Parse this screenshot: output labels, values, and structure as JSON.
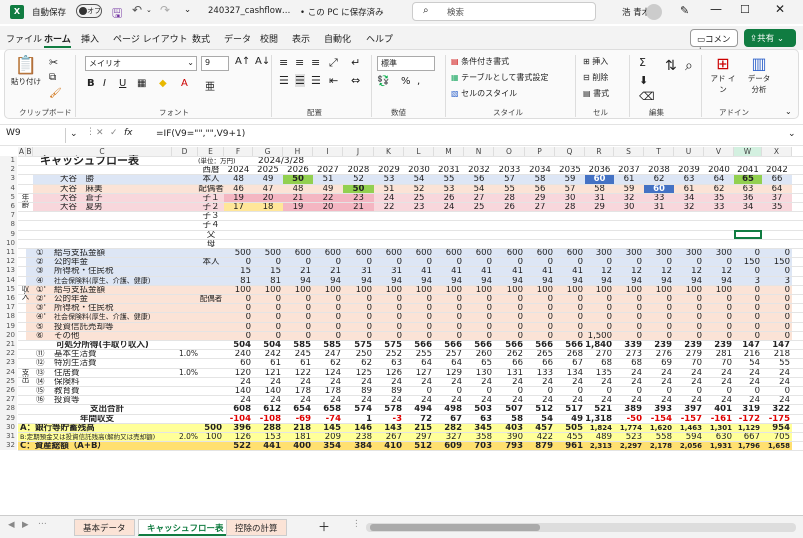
{
  "title_bar": {
    "autosave": "自動保存",
    "toggle": "オフ",
    "filename": "240327_cashflow…",
    "save_state": "• この PC に保存済み",
    "search": "検索",
    "user": "浩 青木"
  },
  "tabs": [
    "ファイル",
    "ホーム",
    "挿入",
    "ページ レイアウト",
    "数式",
    "データ",
    "校閲",
    "表示",
    "自動化",
    "ヘルプ"
  ],
  "comment_btn": "コメント",
  "share_btn": "共有",
  "ribbon": {
    "paste": "貼り付け",
    "font_name": "メイリオ",
    "font_size": "9",
    "number_format": "標準",
    "cond_format": "条件付き書式",
    "table_format": "テーブルとして書式設定",
    "cell_style": "セルのスタイル",
    "insert": "挿入",
    "delete": "削除",
    "format": "書式",
    "addin": "アド イン",
    "analyze": "データ 分析",
    "groups": [
      "クリップボード",
      "フォント",
      "配置",
      "数値",
      "スタイル",
      "セル",
      "編集",
      "アドイン"
    ]
  },
  "formula_bar": {
    "namebox": "W9",
    "fx": "fx",
    "formula": "=IF(V9=\"\",\"\",V9+1)"
  },
  "columns": [
    "A",
    "B",
    "C",
    "D",
    "E",
    "F",
    "G",
    "H",
    "I",
    "J",
    "K",
    "L",
    "M",
    "N",
    "O",
    "P",
    "Q",
    "R",
    "S",
    "T",
    "U",
    "V",
    "W",
    "X"
  ],
  "sheet": {
    "title": "キャッシュフロー表",
    "unit": "(単位：万円)",
    "date": "2024/3/28",
    "year_label": "西暦",
    "years": [
      "2024",
      "2025",
      "2026",
      "2027",
      "2028",
      "2029",
      "2030",
      "2031",
      "2032",
      "2033",
      "2034",
      "2035",
      "2036",
      "2037",
      "2038",
      "2039",
      "2040",
      "2041",
      "2042"
    ],
    "family_side": "年齢",
    "family": [
      {
        "name": "大谷　勝",
        "rel": "本人",
        "vals": [
          "48",
          "49",
          "50",
          "51",
          "52",
          "53",
          "54",
          "55",
          "56",
          "57",
          "58",
          "59",
          "60",
          "61",
          "62",
          "63",
          "64",
          "65",
          "66"
        ]
      },
      {
        "name": "大谷　麻美",
        "rel": "配偶者",
        "vals": [
          "46",
          "47",
          "48",
          "49",
          "50",
          "51",
          "52",
          "53",
          "54",
          "55",
          "56",
          "57",
          "58",
          "59",
          "60",
          "61",
          "62",
          "63",
          "64"
        ]
      },
      {
        "name": "大谷　蒼子",
        "rel": "子１",
        "vals": [
          "19",
          "20",
          "21",
          "22",
          "23",
          "24",
          "25",
          "26",
          "27",
          "28",
          "29",
          "30",
          "31",
          "32",
          "33",
          "34",
          "35",
          "36",
          "37"
        ]
      },
      {
        "name": "大谷　夏男",
        "rel": "子２",
        "vals": [
          "17",
          "18",
          "19",
          "20",
          "21",
          "22",
          "23",
          "24",
          "25",
          "26",
          "27",
          "28",
          "29",
          "30",
          "31",
          "32",
          "33",
          "34",
          "35"
        ]
      },
      {
        "name": "",
        "rel": "子３",
        "vals": []
      },
      {
        "name": "",
        "rel": "子４",
        "vals": []
      },
      {
        "name": "",
        "rel": "父",
        "vals": []
      },
      {
        "name": "",
        "rel": "母",
        "vals": []
      }
    ],
    "income_side": "収入",
    "income_self_label": "本人",
    "income_spouse_label": "配偶者",
    "income": [
      {
        "no": "①",
        "label": "給与支払金額",
        "vals": [
          "500",
          "500",
          "600",
          "600",
          "600",
          "600",
          "600",
          "600",
          "600",
          "600",
          "600",
          "600",
          "300",
          "300",
          "300",
          "300",
          "300",
          "0",
          "0"
        ]
      },
      {
        "no": "②",
        "label": "公的年金",
        "vals": [
          "0",
          "0",
          "0",
          "0",
          "0",
          "0",
          "0",
          "0",
          "0",
          "0",
          "0",
          "0",
          "0",
          "0",
          "0",
          "0",
          "0",
          "150",
          "150"
        ]
      },
      {
        "no": "③",
        "label": "所得税・住民税",
        "vals": [
          "15",
          "15",
          "21",
          "21",
          "31",
          "31",
          "41",
          "41",
          "41",
          "41",
          "41",
          "41",
          "12",
          "12",
          "12",
          "12",
          "12",
          "0",
          "0"
        ]
      },
      {
        "no": "④",
        "label": "社会保険料(厚生、介護、健康)",
        "vals": [
          "81",
          "81",
          "94",
          "94",
          "94",
          "94",
          "94",
          "94",
          "94",
          "94",
          "94",
          "94",
          "94",
          "94",
          "94",
          "94",
          "94",
          "3",
          "3"
        ]
      },
      {
        "no": "①'",
        "label": "給与支払金額",
        "vals": [
          "100",
          "100",
          "100",
          "100",
          "100",
          "100",
          "100",
          "100",
          "100",
          "100",
          "100",
          "100",
          "100",
          "100",
          "100",
          "100",
          "100",
          "0",
          "0"
        ]
      },
      {
        "no": "②'",
        "label": "公的年金",
        "vals": [
          "0",
          "0",
          "0",
          "0",
          "0",
          "0",
          "0",
          "0",
          "0",
          "0",
          "0",
          "0",
          "0",
          "0",
          "0",
          "0",
          "0",
          "0",
          "0"
        ]
      },
      {
        "no": "③'",
        "label": "所得税・住民税",
        "vals": [
          "0",
          "0",
          "0",
          "0",
          "0",
          "0",
          "0",
          "0",
          "0",
          "0",
          "0",
          "0",
          "0",
          "0",
          "0",
          "0",
          "0",
          "0",
          "0"
        ]
      },
      {
        "no": "④'",
        "label": "社会保険料(厚生、介護、健康)",
        "vals": [
          "0",
          "0",
          "0",
          "0",
          "0",
          "0",
          "0",
          "0",
          "0",
          "0",
          "0",
          "0",
          "0",
          "0",
          "0",
          "0",
          "0",
          "0",
          "0"
        ]
      },
      {
        "no": "⑤",
        "label": "投資信託売却等",
        "vals": [
          "0",
          "0",
          "0",
          "0",
          "0",
          "0",
          "0",
          "0",
          "0",
          "0",
          "0",
          "0",
          "0",
          "0",
          "0",
          "0",
          "0",
          "0",
          "0"
        ]
      },
      {
        "no": "⑥",
        "label": "その他",
        "vals": [
          "0",
          "0",
          "0",
          "0",
          "0",
          "0",
          "0",
          "0",
          "0",
          "0",
          "0",
          "0",
          "1,500",
          "0",
          "0",
          "0",
          "0",
          "0",
          "0"
        ]
      }
    ],
    "disposable": {
      "label": "可処分所得(手取り収入)",
      "vals": [
        "504",
        "504",
        "585",
        "585",
        "575",
        "575",
        "566",
        "566",
        "566",
        "566",
        "566",
        "566",
        "1,840",
        "339",
        "239",
        "239",
        "239",
        "147",
        "147"
      ]
    },
    "expense_side": "支出",
    "expense": [
      {
        "no": "⑪",
        "label": "基本生活費",
        "rate": "1.0%",
        "vals": [
          "240",
          "242",
          "245",
          "247",
          "250",
          "252",
          "255",
          "257",
          "260",
          "262",
          "265",
          "268",
          "270",
          "273",
          "276",
          "279",
          "281",
          "216",
          "218"
        ]
      },
      {
        "no": "⑫",
        "label": "特別生活費",
        "rate": "",
        "vals": [
          "60",
          "61",
          "61",
          "62",
          "62",
          "63",
          "64",
          "64",
          "65",
          "66",
          "66",
          "67",
          "68",
          "68",
          "69",
          "70",
          "70",
          "54",
          "55"
        ]
      },
      {
        "no": "⑬",
        "label": "住居費",
        "rate": "1.0%",
        "vals": [
          "120",
          "121",
          "122",
          "124",
          "125",
          "126",
          "127",
          "129",
          "130",
          "131",
          "133",
          "134",
          "135",
          "24",
          "24",
          "24",
          "24",
          "24",
          "24"
        ]
      },
      {
        "no": "⑭",
        "label": "保険料",
        "rate": "",
        "vals": [
          "24",
          "24",
          "24",
          "24",
          "24",
          "24",
          "24",
          "24",
          "24",
          "24",
          "24",
          "24",
          "24",
          "24",
          "24",
          "24",
          "24",
          "24",
          "24"
        ]
      },
      {
        "no": "⑮",
        "label": "教育費",
        "rate": "",
        "vals": [
          "140",
          "140",
          "178",
          "178",
          "89",
          "89",
          "0",
          "0",
          "0",
          "0",
          "0",
          "0",
          "0",
          "0",
          "0",
          "0",
          "0",
          "0",
          "0"
        ]
      },
      {
        "no": "⑯",
        "label": "投資等",
        "rate": "",
        "vals": [
          "24",
          "24",
          "24",
          "24",
          "24",
          "24",
          "24",
          "24",
          "24",
          "24",
          "24",
          "24",
          "24",
          "24",
          "24",
          "24",
          "24",
          "24",
          "24"
        ]
      }
    ],
    "expense_total": {
      "label": "支出合計",
      "vals": [
        "608",
        "612",
        "654",
        "658",
        "574",
        "578",
        "494",
        "498",
        "503",
        "507",
        "512",
        "517",
        "521",
        "389",
        "393",
        "397",
        "401",
        "319",
        "322"
      ]
    },
    "balance": {
      "label": "年間収支",
      "vals": [
        "-104",
        "-108",
        "-69",
        "-74",
        "1",
        "-3",
        "72",
        "67",
        "63",
        "58",
        "54",
        "49",
        "1,318",
        "-50",
        "-154",
        "-157",
        "-161",
        "-172",
        "-175"
      ]
    },
    "bank": {
      "label": "A：銀行等貯蓄残高",
      "base": "500",
      "vals": [
        "396",
        "288",
        "218",
        "145",
        "146",
        "143",
        "215",
        "282",
        "345",
        "403",
        "457",
        "505",
        "1,824",
        "1,774",
        "1,620",
        "1,463",
        "1,301",
        "1,129",
        "954"
      ]
    },
    "fund": {
      "label": "B:定期預金又は投資信託残高(解約又は売却額)",
      "rate": "2.0%",
      "base": "100",
      "vals": [
        "126",
        "153",
        "181",
        "209",
        "238",
        "267",
        "297",
        "327",
        "358",
        "390",
        "422",
        "455",
        "489",
        "523",
        "558",
        "594",
        "630",
        "667",
        "705"
      ]
    },
    "total": {
      "label": "C：資産総額（A+B）",
      "vals": [
        "522",
        "441",
        "400",
        "354",
        "384",
        "410",
        "512",
        "609",
        "703",
        "793",
        "879",
        "961",
        "2,313",
        "2,297",
        "2,178",
        "2,056",
        "1,931",
        "1,796",
        "1,658"
      ]
    }
  },
  "sheet_tabs": [
    "基本データ",
    "キャッシュフロー表",
    "控除の計算"
  ],
  "colors": {
    "green_header": "#107c41",
    "peach": "#fbe3d6",
    "blue": "#dde6f5",
    "yellow": "#ffff99",
    "highlight": "#4472c4",
    "red": "#e00000"
  }
}
